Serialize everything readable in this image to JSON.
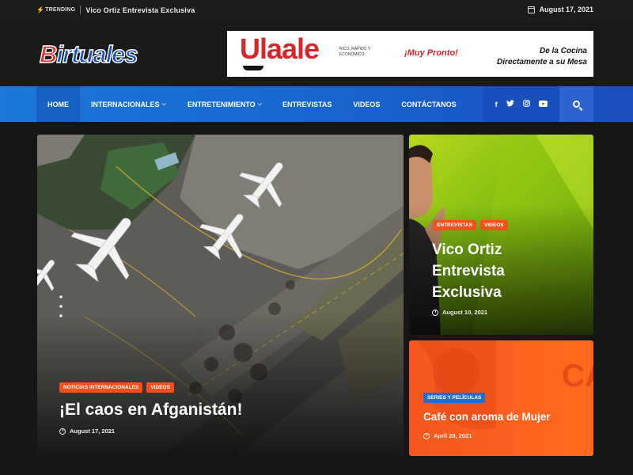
{
  "topbar": {
    "trending_label": "TRENDING",
    "trending_headline": "Vico Ortiz Entrevista Exclusiva",
    "date": "August 17, 2021"
  },
  "header": {
    "logo_first": "B",
    "logo_rest": "irtuales",
    "ad": {
      "brand": "Ulaale",
      "tagline": "RICO, RÁPIDO Y ECONÓMICO",
      "soon": "¡Muy Pronto!",
      "right_line1": "De la Cocina",
      "right_line2": "Directamente a su Mesa"
    }
  },
  "nav": {
    "items": [
      {
        "label": "HOME"
      },
      {
        "label": "INTERNACIONALES",
        "dropdown": true
      },
      {
        "label": "ENTRETENIMIENTO",
        "dropdown": true
      },
      {
        "label": "ENTREVISTAS"
      },
      {
        "label": "VIDEOS"
      },
      {
        "label": "CONTÁCTANOS"
      }
    ],
    "social": [
      "f",
      "twitter-icon",
      "instagram-icon",
      "youtube-icon"
    ]
  },
  "featured": {
    "main": {
      "badges": [
        "NOTICIAS INTERNACIONALES",
        "VIDEOS"
      ],
      "title": "¡El caos en Afganistán!",
      "date": "August 17, 2021"
    },
    "side1": {
      "badges": [
        "ENTREVISTAS",
        "VIDEOS"
      ],
      "title": "Vico Ortiz Entrevista Exclusiva",
      "date": "August 10, 2021"
    },
    "side2": {
      "badges": [
        "SERIES Y PELÍCULAS"
      ],
      "title": "Café con aroma de Mujer",
      "date": "April 28, 2021",
      "watermark": "CA"
    }
  },
  "colors": {
    "accent_orange": "#f4501e",
    "nav_blue": "#1766cd",
    "badge_blue": "#1b6fd6"
  }
}
